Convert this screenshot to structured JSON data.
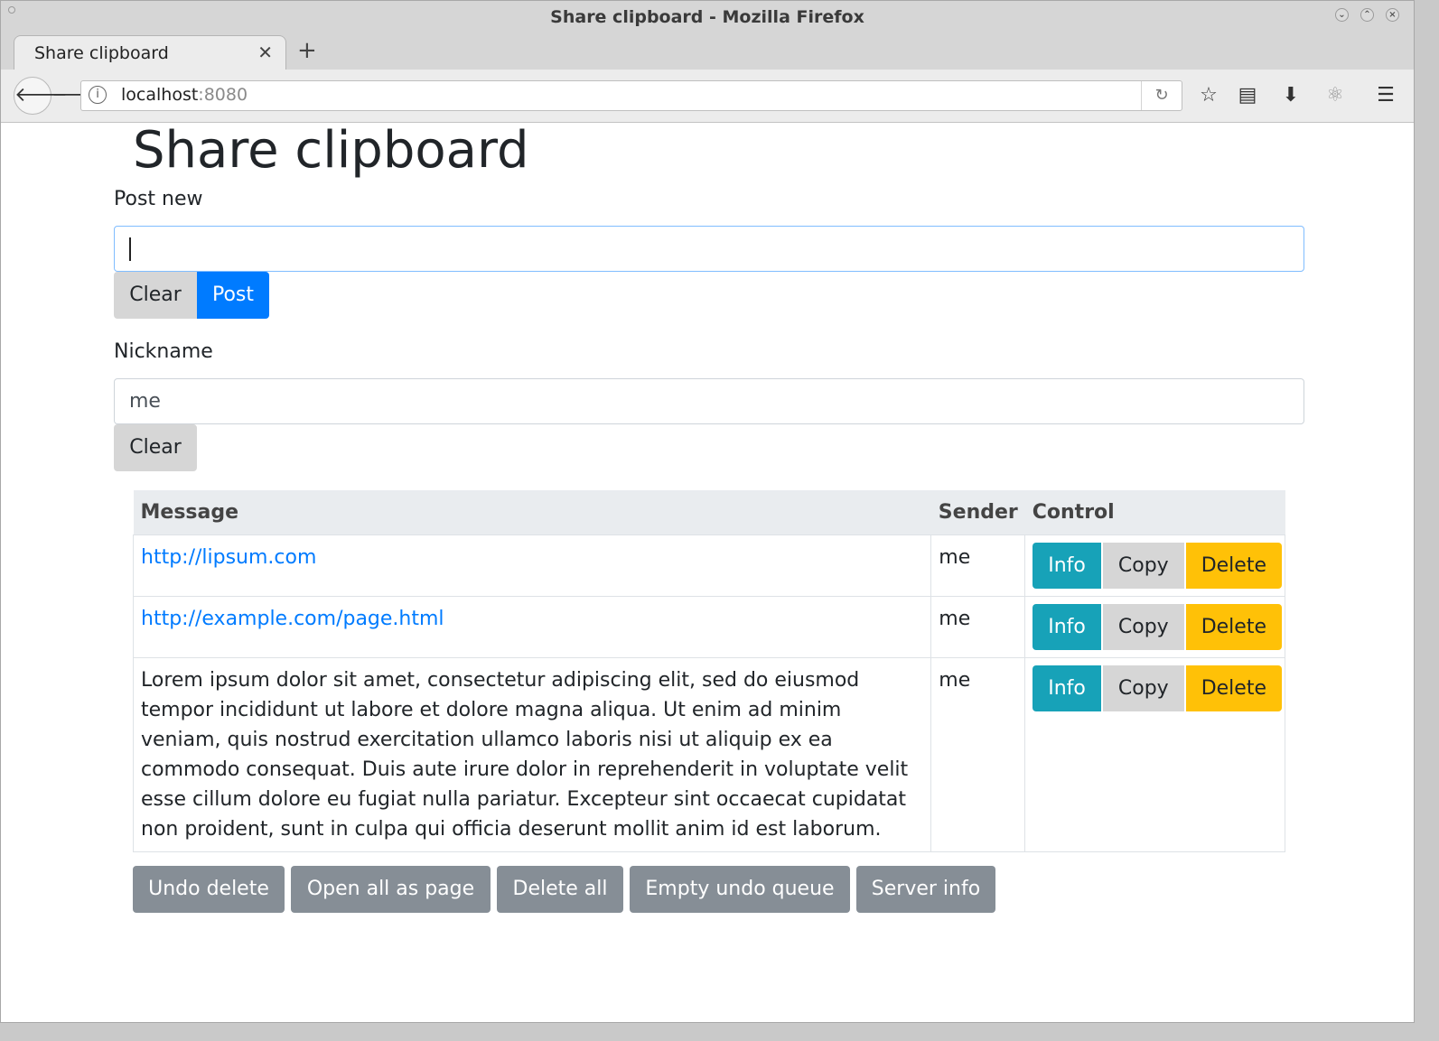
{
  "window": {
    "title": "Share clipboard - Mozilla Firefox"
  },
  "tab": {
    "title": "Share clipboard"
  },
  "urlbar": {
    "host": "localhost",
    "port": ":8080"
  },
  "page": {
    "heading": "Share clipboard",
    "post_new": {
      "label": "Post new",
      "value": "",
      "clear": "Clear",
      "post": "Post"
    },
    "nickname": {
      "label": "Nickname",
      "value": "me",
      "clear": "Clear"
    }
  },
  "table": {
    "headers": [
      "Message",
      "Sender",
      "Control"
    ],
    "rows": [
      {
        "message": "http://lipsum.com",
        "is_link": true,
        "sender": "me"
      },
      {
        "message": "http://example.com/page.html",
        "is_link": true,
        "sender": "me"
      },
      {
        "message": "Lorem ipsum dolor sit amet, consectetur adipiscing elit, sed do eiusmod tempor incididunt ut labore et dolore magna aliqua. Ut enim ad minim veniam, quis nostrud exercitation ullamco laboris nisi ut aliquip ex ea commodo consequat. Duis aute irure dolor in reprehenderit in voluptate velit esse cillum dolore eu fugiat nulla pariatur. Excepteur sint occaecat cupidatat non proident, sunt in culpa qui officia deserunt mollit anim id est laborum.",
        "is_link": false,
        "sender": "me"
      }
    ],
    "controls": {
      "info": "Info",
      "copy": "Copy",
      "delete": "Delete"
    }
  },
  "actions": [
    "Undo delete",
    "Open all as page",
    "Delete all",
    "Empty undo queue",
    "Server info"
  ],
  "colors": {
    "primary": "#007bff",
    "info": "#17a2b8",
    "warning": "#ffc107",
    "secondary": "#868e96"
  },
  "icons": [
    "close-icon",
    "new-tab-icon",
    "back-arrow-icon",
    "forward-arrow-icon",
    "info-icon",
    "reload-icon",
    "bookmark-star-icon",
    "reader-list-icon",
    "download-icon",
    "react-extension-icon",
    "hamburger-menu-icon"
  ]
}
